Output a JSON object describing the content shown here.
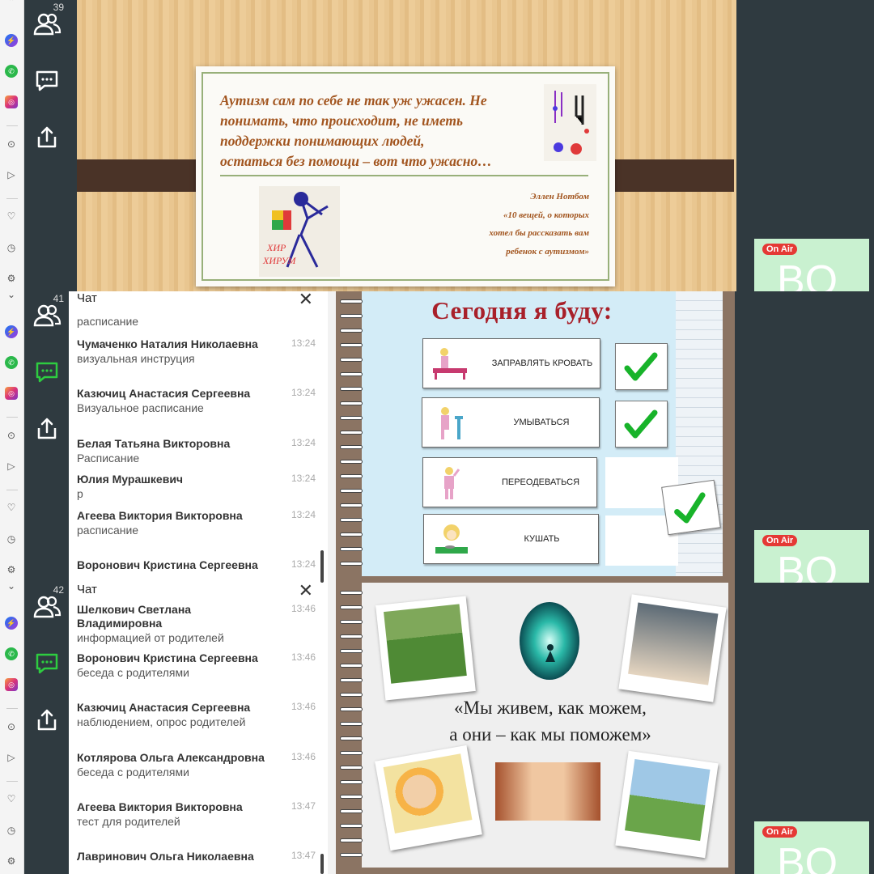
{
  "panels": [
    {
      "participants": "39"
    },
    {
      "participants": "41",
      "chat": {
        "title": "Чат",
        "fragment": "расписание",
        "messages": [
          {
            "name": "Чумаченко Наталия Николаевна",
            "time": "13:24",
            "text": "визуальная инструция"
          },
          {
            "name": "Казючиц Анастасия Сергеевна",
            "time": "13:24",
            "text": "Визуальное расписание"
          },
          {
            "name": "Белая Татьяна Викторовна",
            "time": "13:24",
            "text": "Расписание"
          },
          {
            "name": "Юлия Мурашкевич",
            "time": "13:24",
            "text": "р"
          },
          {
            "name": "Агеева Виктория Викторовна",
            "time": "13:24",
            "text": "расписание"
          },
          {
            "name": "Воронович Кристина Сергеевна",
            "time": "13:24",
            "text": ""
          }
        ]
      }
    },
    {
      "participants": "42",
      "chat": {
        "title": "Чат",
        "messages": [
          {
            "name": "Шелкович Светлана Владимировна",
            "time": "13:46",
            "text": "информацией от родителей"
          },
          {
            "name": "Воронович Кристина Сергеевна",
            "time": "13:46",
            "text": "беседа с родителями"
          },
          {
            "name": "Казючиц Анастасия Сергеевна",
            "time": "13:46",
            "text": "наблюдением, опрос родителей"
          },
          {
            "name": "Котлярова Ольга Александровна",
            "time": "13:46",
            "text": "беседа с родителями"
          },
          {
            "name": "Агеева Виктория Викторовна",
            "time": "13:47",
            "text": "тест для родителей"
          },
          {
            "name": "Лавринович Ольга Николаевна",
            "time": "13:47",
            "text": ""
          }
        ]
      }
    }
  ],
  "on_air": {
    "badge": "On Air",
    "initials": "BO"
  },
  "slide1": {
    "quote_lines": [
      "Аутизм сам по себе не так уж ужасен. Не",
      "понимать, что происходит, не иметь",
      "поддержки понимающих людей,",
      " остаться без помощи – вот что ужасно…"
    ],
    "source_lines": [
      "Эллен Нотбом",
      "«10 вещей, о которых",
      "хотел бы рассказать вам",
      "ребенок с аутизмом»"
    ],
    "drawing_caption_1": "ХИР",
    "drawing_caption_2": "ХИРУМ"
  },
  "slide2": {
    "title": "Сегодня я буду:",
    "tasks": [
      {
        "label": "ЗАПРАВЛЯТЬ КРОВАТЬ",
        "done": true
      },
      {
        "label": "УМЫВАТЬСЯ",
        "done": true
      },
      {
        "label": "ПЕРЕОДЕВАТЬСЯ",
        "done": false
      },
      {
        "label": "КУШАТЬ",
        "done": false
      }
    ]
  },
  "slide3": {
    "slogan_lines": [
      "«Мы живем, как можем,",
      "а они – как мы поможем»"
    ]
  },
  "colors": {
    "rail": "#2f3a40",
    "accent_green": "#2ecc40",
    "check_green": "#18b32a",
    "title_red": "#a8202a",
    "quote_brown": "#a2551f"
  },
  "icons": [
    "participants-icon",
    "chat-icon",
    "share-icon",
    "messenger-icon",
    "whatsapp-icon",
    "instagram-icon",
    "play-icon",
    "send-icon",
    "heart-icon",
    "clock-icon",
    "settings-icon",
    "close-icon",
    "checkmark-icon"
  ]
}
